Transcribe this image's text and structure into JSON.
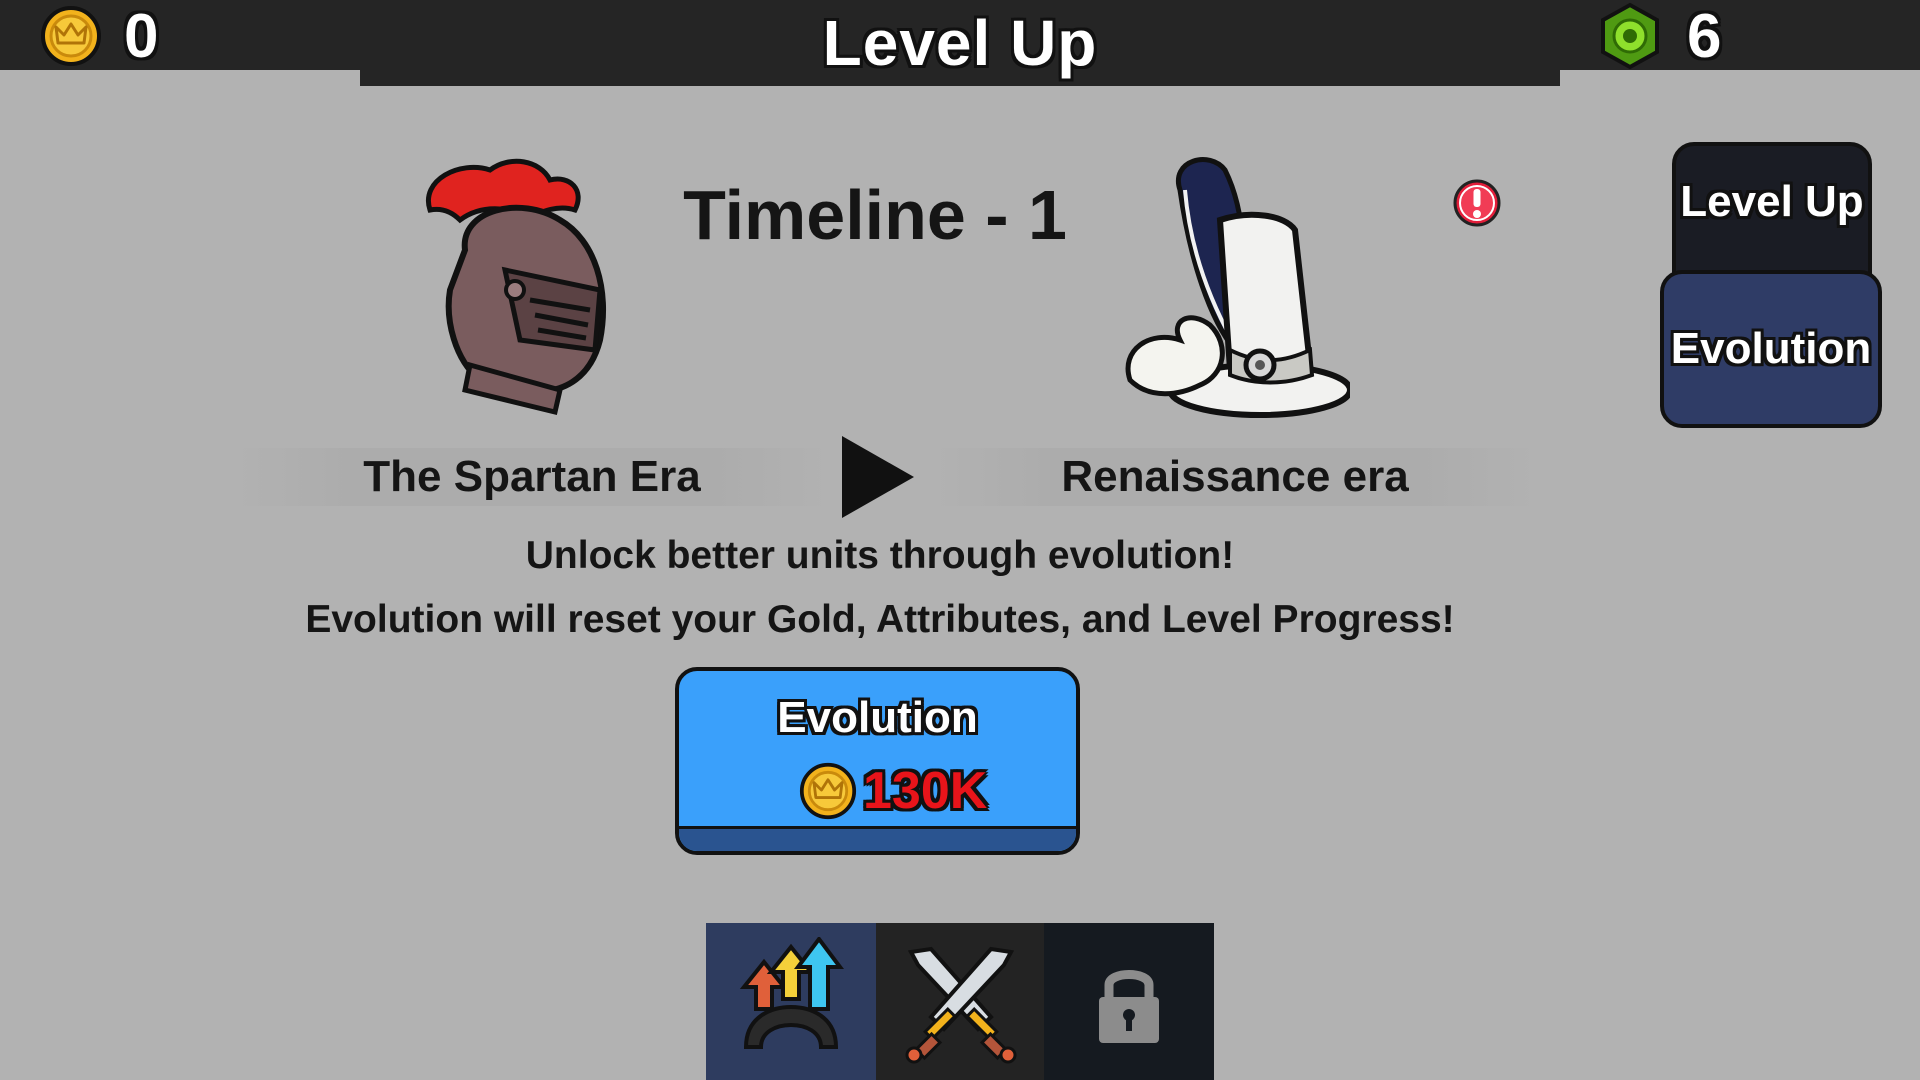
{
  "header": {
    "title": "Level Up",
    "gold": "0",
    "gems": "6"
  },
  "side_tabs": {
    "level_up": "Level Up",
    "evolution": "Evolution"
  },
  "timeline": {
    "title": "Timeline - 1",
    "from_era": "The Spartan Era",
    "to_era": "Renaissance era",
    "from_icon": "knight-helmet-icon",
    "to_icon": "plumed-top-hat-icon"
  },
  "messages": {
    "line1": "Unlock better units through evolution!",
    "line2": "Evolution will reset your Gold, Attributes, and Level Progress!"
  },
  "evolution_button": {
    "label": "Evolution",
    "cost": "130K",
    "cost_icon": "gold-crown-coin-icon"
  },
  "bottom_tabs": [
    {
      "name": "upgrade",
      "icon": "upgrade-arrows-icon",
      "active": true
    },
    {
      "name": "battle",
      "icon": "crossed-swords-icon",
      "active": false
    },
    {
      "name": "locked",
      "icon": "lock-icon",
      "active": false
    }
  ],
  "colors": {
    "background": "#b2b2b2",
    "bar": "#252525",
    "button_blue": "#3aa0fb",
    "cost_red": "#e8141a",
    "side_tab_active": "#2f3c66"
  }
}
